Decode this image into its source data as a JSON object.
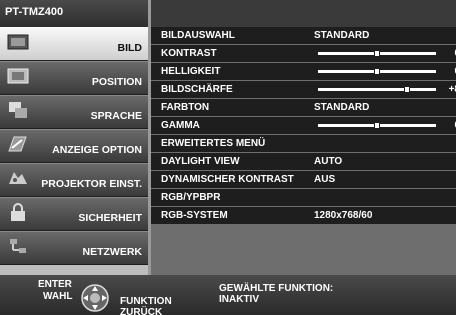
{
  "header": {
    "model": "PT-TMZ400"
  },
  "sidebar": {
    "items": [
      {
        "label": "BILD",
        "icon": "picture-icon",
        "active": true
      },
      {
        "label": "POSITION",
        "icon": "position-icon",
        "active": false
      },
      {
        "label": "SPRACHE",
        "icon": "language-icon",
        "active": false
      },
      {
        "label": "ANZEIGE OPTION",
        "icon": "display-option-icon",
        "active": false
      },
      {
        "label": "PROJEKTOR EINST.",
        "icon": "projector-setup-icon",
        "active": false
      },
      {
        "label": "SICHERHEIT",
        "icon": "lock-icon",
        "active": false
      },
      {
        "label": "NETZWERK",
        "icon": "network-icon",
        "active": false
      }
    ]
  },
  "menu": {
    "rows": [
      {
        "name": "BILDAUSWAHL",
        "value": "STANDARD"
      },
      {
        "name": "KONTRAST",
        "slider": 0.5,
        "number": "0"
      },
      {
        "name": "HELLIGKEIT",
        "slider": 0.5,
        "number": "0"
      },
      {
        "name": "BILDSCHÄRFE",
        "slider": 0.75,
        "number": "+8"
      },
      {
        "name": "FARBTON",
        "value": "STANDARD"
      },
      {
        "name": "GAMMA",
        "slider": 0.5,
        "number": "0"
      },
      {
        "name": "ERWEITERTES MENÜ"
      },
      {
        "name": "DAYLIGHT VIEW",
        "value": "AUTO"
      },
      {
        "name": "DYNAMISCHER KONTRAST",
        "value": "AUS"
      },
      {
        "name": "RGB/YPBPR"
      },
      {
        "name": "RGB-SYSTEM",
        "value": "1280x768/60"
      }
    ]
  },
  "footer": {
    "enter": "ENTER",
    "wahl": "WAHL",
    "funktion": "FUNKTION",
    "zurueck": "ZURÜCK",
    "function_label": "GEWÄHLTE FUNKTION:",
    "function_status": "INAKTIV"
  }
}
